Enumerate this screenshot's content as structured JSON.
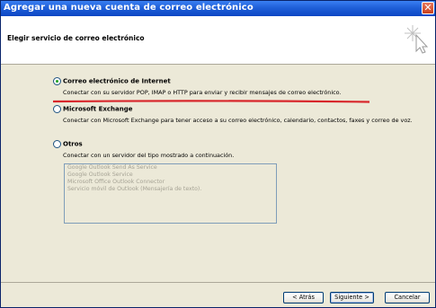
{
  "window": {
    "title": "Agregar una nueva cuenta de correo electrónico",
    "close_symbol": "✕"
  },
  "header": {
    "title": "Elegir servicio de correo electrónico"
  },
  "options": [
    {
      "label": "Correo electrónico de Internet",
      "selected": true,
      "description": "Conectar con su servidor POP, IMAP o HTTP para enviar y recibir mensajes de correo electrónico."
    },
    {
      "label": "Microsoft Exchange",
      "selected": false,
      "description": "Conectar con Microsoft Exchange para tener acceso a su correo electrónico, calendario, contactos, faxes y correo de voz."
    },
    {
      "label": "Otros",
      "selected": false,
      "description": "Conectar con un servidor del tipo mostrado a continuación."
    }
  ],
  "other_types": [
    "Google Outlook Send As Service",
    "Google Outlook Service",
    "Microsoft Office Outlook Connector",
    "Servicio móvil de Outlook (Mensajería de texto)."
  ],
  "buttons": {
    "back": "< Atrás",
    "next": "Siguiente >",
    "cancel": "Cancelar"
  },
  "colors": {
    "title_bar": "#0c46c4",
    "annotation_underline": "#d8262b",
    "radio_dot": "#21a121"
  }
}
